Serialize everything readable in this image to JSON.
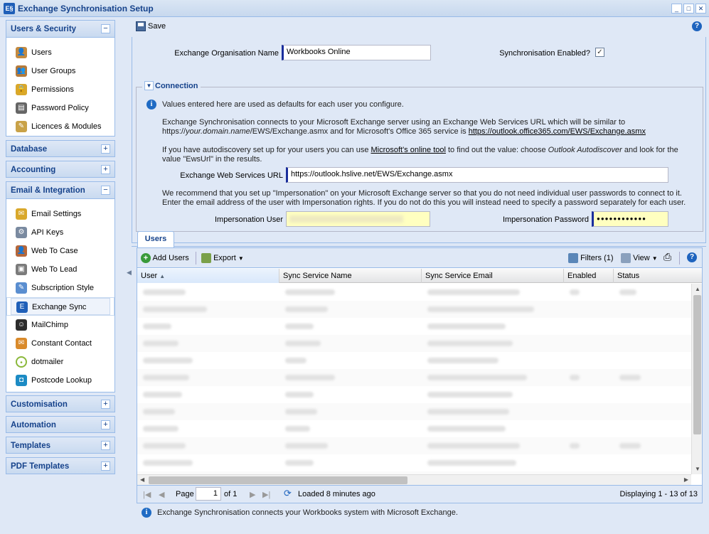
{
  "window": {
    "title": "Exchange Synchronisation Setup",
    "app_icon": "E§",
    "buttons": [
      "_",
      "□",
      "✕"
    ]
  },
  "sidebar": {
    "groups": [
      {
        "title": "Users & Security",
        "toggle": "−",
        "items": [
          {
            "label": "Users",
            "icon": "user-icon"
          },
          {
            "label": "User Groups",
            "icon": "user-groups-icon"
          },
          {
            "label": "Permissions",
            "icon": "padlock-icon"
          },
          {
            "label": "Password Policy",
            "icon": "password-policy-icon"
          },
          {
            "label": "Licences & Modules",
            "icon": "licences-icon"
          }
        ]
      },
      {
        "title": "Database",
        "toggle": "+"
      },
      {
        "title": "Accounting",
        "toggle": "+"
      },
      {
        "title": "Email & Integration",
        "toggle": "−",
        "items": [
          {
            "label": "Email Settings",
            "icon": "email-settings-icon"
          },
          {
            "label": "API Keys",
            "icon": "gear-icon"
          },
          {
            "label": "Web To Case",
            "icon": "web-to-case-icon"
          },
          {
            "label": "Web To Lead",
            "icon": "web-to-lead-icon"
          },
          {
            "label": "Subscription Style",
            "icon": "subscription-icon"
          },
          {
            "label": "Exchange Sync",
            "icon": "exchange-icon",
            "selected": true
          },
          {
            "label": "MailChimp",
            "icon": "mailchimp-icon"
          },
          {
            "label": "Constant Contact",
            "icon": "constant-contact-icon"
          },
          {
            "label": "dotmailer",
            "icon": "dotmailer-icon"
          },
          {
            "label": "Postcode Lookup",
            "icon": "postcode-icon"
          }
        ]
      },
      {
        "title": "Customisation",
        "toggle": "+"
      },
      {
        "title": "Automation",
        "toggle": "+"
      },
      {
        "title": "Templates",
        "toggle": "+"
      },
      {
        "title": "PDF Templates",
        "toggle": "+"
      }
    ]
  },
  "toolbar": {
    "save_label": "Save",
    "help": "?"
  },
  "form": {
    "org_name_label": "Exchange Organisation Name",
    "org_name_value": "Workbooks Online",
    "sync_enabled_label": "Synchronisation Enabled?",
    "sync_enabled_check": "✓",
    "connection": {
      "title": "Connection",
      "toggle": "▼",
      "info_icon": "i",
      "defaults_note": "Values entered here are used as defaults for each user you configure.",
      "para1_a": "Exchange Synchronisation connects to your Microsoft Exchange server using an Exchange Web Services URL which will be similar to",
      "para1_b": "https://",
      "para1_c": "your.domain.name",
      "para1_d": "/EWS/Exchange.asmx and for Microsoft's Office 365 service is ",
      "para1_link": "https://outlook.office365.com/EWS/Exchange.asmx",
      "para2_a": "If you have autodiscovery set up for your users you can use ",
      "para2_link": "Microsoft's online tool",
      "para2_b": " to find out the value: choose ",
      "para2_em": "Outlook Autodiscover",
      "para2_c": " and look for the",
      "para2_d": "value \"EwsUrl\" in the results.",
      "ews_label": "Exchange Web Services URL",
      "ews_value": "https://outlook.hslive.net/EWS/Exchange.asmx",
      "para3_a": "We recommend that you set up \"Impersonation\" on your Microsoft Exchange server so that you do not need individual user passwords to connect to it.",
      "para3_b": "Enter the email address of the user with Impersonation rights. If you do not do this you will instead need to specify a password separately for each user.",
      "imp_user_label": "Impersonation User",
      "imp_pw_label": "Impersonation Password",
      "imp_pw_value": "●●●●●●●●●●●●"
    }
  },
  "users_tab": {
    "tab_label": "Users",
    "add_users": "Add Users",
    "export": "Export",
    "filters": "Filters (1)",
    "view": "View",
    "columns": [
      "User",
      "Sync Service Name",
      "Sync Service Email",
      "Enabled",
      "Status"
    ],
    "sort_indicator": "▲",
    "pager": {
      "page_label": "Page",
      "page_value": "1",
      "of_label": "of 1",
      "loaded": "Loaded 8 minutes ago",
      "displaying": "Displaying 1 - 13 of 13"
    }
  },
  "footer": {
    "text": "Exchange Synchronisation connects your Workbooks system with Microsoft Exchange."
  }
}
